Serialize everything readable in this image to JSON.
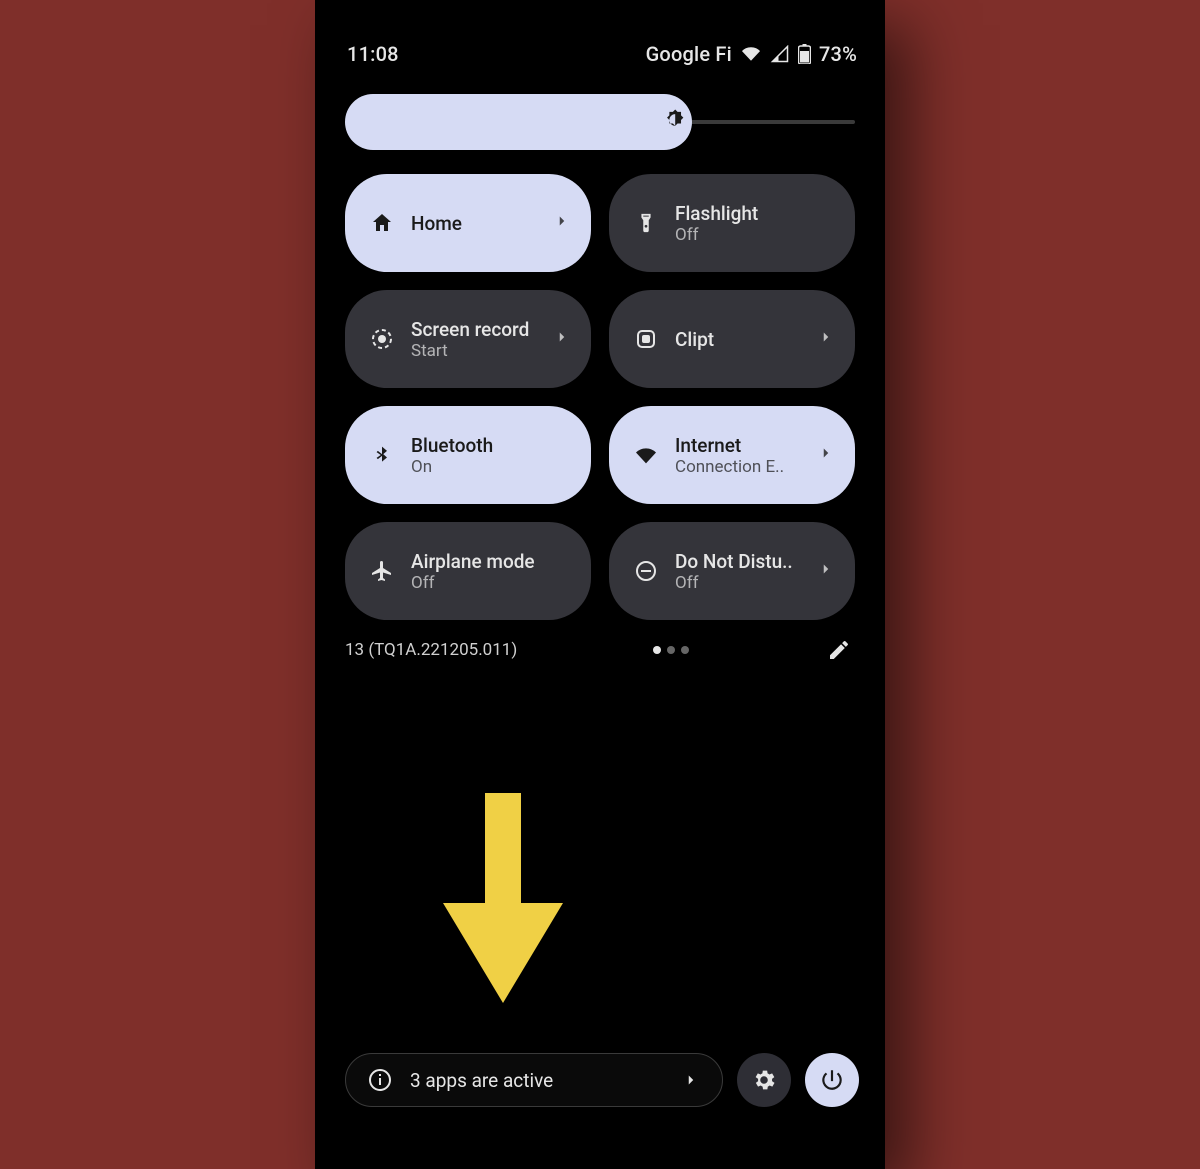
{
  "status": {
    "time": "11:08",
    "carrier": "Google Fi",
    "battery": "73%"
  },
  "brightness": {
    "percent": 68
  },
  "tiles": [
    {
      "title": "Home",
      "sub": "",
      "on": true
    },
    {
      "title": "Flashlight",
      "sub": "Off",
      "on": false
    },
    {
      "title": "Screen record",
      "sub": "Start",
      "on": false
    },
    {
      "title": "Clipt",
      "sub": "",
      "on": false
    },
    {
      "title": "Bluetooth",
      "sub": "On",
      "on": true
    },
    {
      "title": "Internet",
      "sub": "Connection E..",
      "on": true
    },
    {
      "title": "Airplane mode",
      "sub": "Off",
      "on": false
    },
    {
      "title": "Do Not Distu..",
      "sub": "Off",
      "on": false
    }
  ],
  "footer": {
    "build": "13 (TQ1A.221205.011)"
  },
  "bottom": {
    "active_apps": "3 apps are active"
  }
}
